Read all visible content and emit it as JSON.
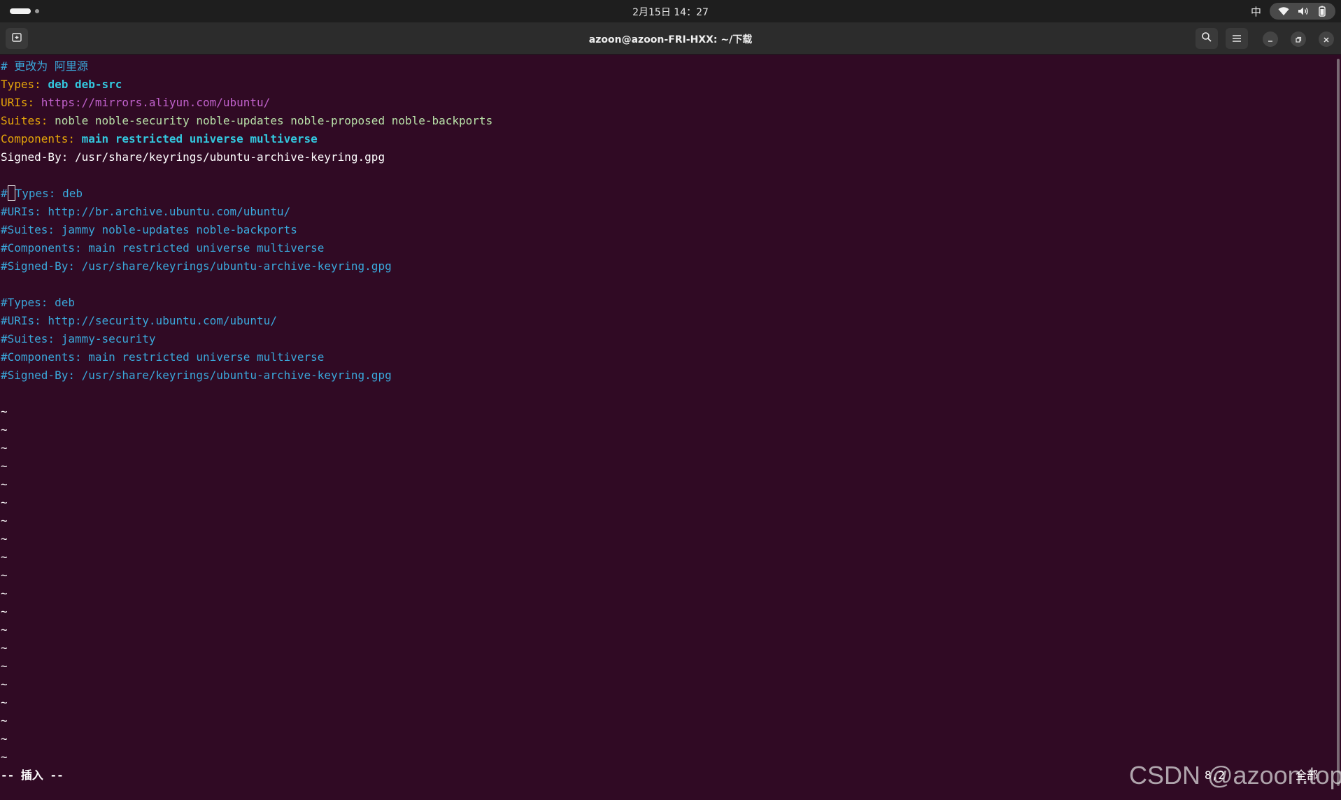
{
  "topbar": {
    "datetime": "2月15日  14：27",
    "input_method": "中",
    "icons": [
      "wifi-icon",
      "volume-icon",
      "battery-icon"
    ]
  },
  "window": {
    "title": "azoon@azoon-FRI-HXX: ~/下载"
  },
  "editor": {
    "lines": [
      [
        {
          "t": "# 更改为 阿里源",
          "c": "comment"
        }
      ],
      [
        {
          "t": "Types: ",
          "c": "key"
        },
        {
          "t": "deb deb-src",
          "c": "bold"
        }
      ],
      [
        {
          "t": "URIs: ",
          "c": "key"
        },
        {
          "t": "https://mirrors.aliyun.com/ubuntu/",
          "c": "url"
        }
      ],
      [
        {
          "t": "Suites: ",
          "c": "key"
        },
        {
          "t": "noble noble-security noble-updates noble-proposed noble-backports",
          "c": "val"
        }
      ],
      [
        {
          "t": "Components: ",
          "c": "key"
        },
        {
          "t": "main restricted universe multiverse",
          "c": "bold"
        }
      ],
      [
        {
          "t": "Signed-By: /usr/share/keyrings/ubuntu-archive-keyring.gpg",
          "c": "plain"
        }
      ],
      [],
      [
        {
          "t": "#",
          "c": "comment"
        },
        {
          "cursor": true,
          "t": ""
        },
        {
          "t": "Types: deb",
          "c": "comment"
        }
      ],
      [
        {
          "t": "#URIs: http://br.archive.ubuntu.com/ubuntu/",
          "c": "comment"
        }
      ],
      [
        {
          "t": "#Suites: jammy noble-updates noble-backports",
          "c": "comment"
        }
      ],
      [
        {
          "t": "#Components: main restricted universe multiverse",
          "c": "comment"
        }
      ],
      [
        {
          "t": "#Signed-By: /usr/share/keyrings/ubuntu-archive-keyring.gpg",
          "c": "comment"
        }
      ],
      [],
      [
        {
          "t": "#Types: deb",
          "c": "comment"
        }
      ],
      [
        {
          "t": "#URIs: http://security.ubuntu.com/ubuntu/",
          "c": "comment"
        }
      ],
      [
        {
          "t": "#Suites: jammy-security",
          "c": "comment"
        }
      ],
      [
        {
          "t": "#Components: main restricted universe multiverse",
          "c": "comment"
        }
      ],
      [
        {
          "t": "#Signed-By: /usr/share/keyrings/ubuntu-archive-keyring.gpg",
          "c": "comment"
        }
      ],
      [],
      [
        {
          "t": "~",
          "c": "tilde"
        }
      ],
      [
        {
          "t": "~",
          "c": "tilde"
        }
      ],
      [
        {
          "t": "~",
          "c": "tilde"
        }
      ],
      [
        {
          "t": "~",
          "c": "tilde"
        }
      ],
      [
        {
          "t": "~",
          "c": "tilde"
        }
      ],
      [
        {
          "t": "~",
          "c": "tilde"
        }
      ],
      [
        {
          "t": "~",
          "c": "tilde"
        }
      ],
      [
        {
          "t": "~",
          "c": "tilde"
        }
      ],
      [
        {
          "t": "~",
          "c": "tilde"
        }
      ],
      [
        {
          "t": "~",
          "c": "tilde"
        }
      ],
      [
        {
          "t": "~",
          "c": "tilde"
        }
      ],
      [
        {
          "t": "~",
          "c": "tilde"
        }
      ],
      [
        {
          "t": "~",
          "c": "tilde"
        }
      ],
      [
        {
          "t": "~",
          "c": "tilde"
        }
      ],
      [
        {
          "t": "~",
          "c": "tilde"
        }
      ],
      [
        {
          "t": "~",
          "c": "tilde"
        }
      ],
      [
        {
          "t": "~",
          "c": "tilde"
        }
      ],
      [
        {
          "t": "~",
          "c": "tilde"
        }
      ],
      [
        {
          "t": "~",
          "c": "tilde"
        }
      ],
      [
        {
          "t": "~",
          "c": "tilde"
        }
      ]
    ]
  },
  "status": {
    "mode": "-- 插入 --",
    "position": "8,2",
    "scroll": "全部"
  },
  "watermark": "CSDN @azoon.top",
  "colors": {
    "background": "#300a24",
    "comment": "#3aa8db",
    "key": "#e5a50a",
    "url": "#c061cb",
    "bold": "#33c7de"
  }
}
